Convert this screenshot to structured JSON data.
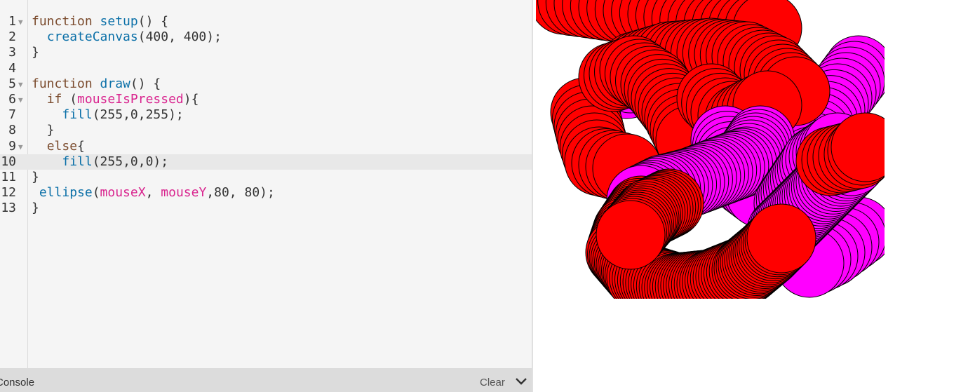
{
  "editor": {
    "active_line": 10,
    "lines": [
      {
        "n": "1",
        "fold": true,
        "tokens": [
          [
            "kw",
            "function "
          ],
          [
            "fn",
            "setup"
          ],
          [
            "p",
            "() {"
          ]
        ]
      },
      {
        "n": "2",
        "fold": false,
        "tokens": [
          [
            "p",
            "  "
          ],
          [
            "fn",
            "createCanvas"
          ],
          [
            "p",
            "(400, 400);"
          ]
        ]
      },
      {
        "n": "3",
        "fold": false,
        "tokens": [
          [
            "p",
            "}"
          ]
        ]
      },
      {
        "n": "4",
        "fold": false,
        "tokens": []
      },
      {
        "n": "5",
        "fold": true,
        "tokens": [
          [
            "kw",
            "function "
          ],
          [
            "fn",
            "draw"
          ],
          [
            "p",
            "() {"
          ]
        ]
      },
      {
        "n": "6",
        "fold": true,
        "tokens": [
          [
            "p",
            "  "
          ],
          [
            "kw",
            "if "
          ],
          [
            "p",
            "("
          ],
          [
            "var",
            "mouseIsPressed"
          ],
          [
            "p",
            "){"
          ]
        ]
      },
      {
        "n": "7",
        "fold": false,
        "tokens": [
          [
            "p",
            "    "
          ],
          [
            "fn",
            "fill"
          ],
          [
            "p",
            "(255,0,255);"
          ]
        ]
      },
      {
        "n": "8",
        "fold": false,
        "tokens": [
          [
            "p",
            "  }"
          ]
        ]
      },
      {
        "n": "9",
        "fold": true,
        "tokens": [
          [
            "p",
            "  "
          ],
          [
            "kw",
            "else"
          ],
          [
            "p",
            "{"
          ]
        ]
      },
      {
        "n": "10",
        "fold": false,
        "tokens": [
          [
            "p",
            "    "
          ],
          [
            "fn",
            "fill"
          ],
          [
            "p",
            "(255,0,0);"
          ]
        ]
      },
      {
        "n": "11",
        "fold": false,
        "tokens": [
          [
            "p",
            "}"
          ]
        ]
      },
      {
        "n": "12",
        "fold": false,
        "tokens": [
          [
            "p",
            " "
          ],
          [
            "fn",
            "ellipse"
          ],
          [
            "p",
            "("
          ],
          [
            "var",
            "mouseX"
          ],
          [
            "p",
            ", "
          ],
          [
            "var",
            "mouseY"
          ],
          [
            "p",
            ",80, 80);"
          ]
        ]
      },
      {
        "n": "13",
        "fold": false,
        "tokens": [
          [
            "p",
            "}"
          ]
        ]
      }
    ]
  },
  "console": {
    "title": "Console",
    "clear_label": "Clear",
    "collapse_icon": "chevron-down-icon"
  },
  "preview": {
    "colors": {
      "red": "#ff0000",
      "magenta": "#ff00ff",
      "stroke": "#000000"
    }
  }
}
